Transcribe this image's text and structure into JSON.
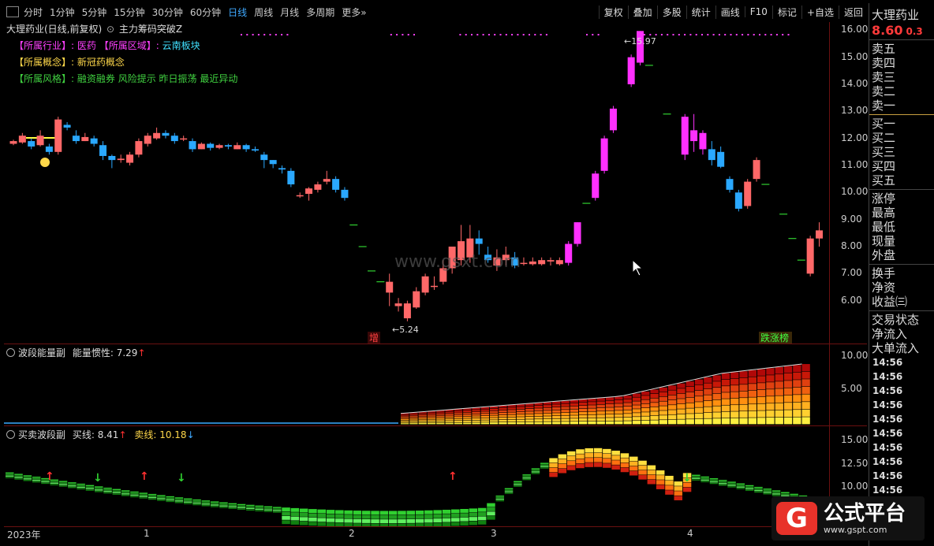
{
  "toolbar": {
    "periods": [
      "分时",
      "1分钟",
      "5分钟",
      "15分钟",
      "30分钟",
      "60分钟",
      "日线",
      "周线",
      "月线",
      "多周期",
      "更多»"
    ],
    "active": "日线",
    "buttons": [
      "复权",
      "叠加",
      "多股",
      "统计",
      "画线",
      "F10",
      "标记",
      "+自选",
      "返回"
    ]
  },
  "main": {
    "title": "大理药业(日线,前复权)",
    "indicator": "主力筹码突破Z",
    "industry_line": {
      "label1": "【所属行业】:",
      "val1": "医药",
      "label2": "【所属区域】:",
      "val2": "云南板块"
    },
    "concept_line": {
      "label": "【所属概念】:",
      "val": "新冠药概念"
    },
    "style_line": {
      "label": "【所属风格】:",
      "val": "融资融券 风险提示 昨日振荡 最近异动"
    },
    "high_label": "15.97",
    "low_label": "5.24",
    "tag_zeng": "增",
    "tag_die": "跌涨榜",
    "watermark": "www.gsxt.com",
    "yticks": [
      "16.00",
      "15.00",
      "14.00",
      "13.00",
      "12.00",
      "11.00",
      "10.00",
      "9.00",
      "8.00",
      "7.00",
      "6.00"
    ]
  },
  "ind1": {
    "name": "波段能量副",
    "label": "能量惯性:",
    "value": "7.29",
    "yticks": [
      "10.00",
      "5.00"
    ]
  },
  "ind2": {
    "name": "买卖波段副",
    "buy_label": "买线:",
    "buy_value": "8.41",
    "sell_label": "卖线:",
    "sell_value": "10.18",
    "yticks": [
      "15.00",
      "12.50",
      "10.00"
    ]
  },
  "xaxis": [
    "2023年",
    "1",
    "2",
    "3",
    "4"
  ],
  "side": {
    "stock": "大理药业",
    "price": "8.60",
    "change": "0.3",
    "items_sell": [
      "卖五",
      "卖四",
      "卖三",
      "卖二",
      "卖一"
    ],
    "items_buy": [
      "买一",
      "买二",
      "买三",
      "买四",
      "买五"
    ],
    "stats": [
      "涨停",
      "最高",
      "最低",
      "现量",
      "外盘"
    ],
    "stats2": [
      "换手",
      "净资",
      "收益㈢"
    ],
    "trade": [
      "交易状态",
      "净流入",
      "大单流入"
    ],
    "times": [
      "14:56",
      "14:56",
      "14:56",
      "14:56",
      "14:56",
      "14:56",
      "14:56",
      "14:56",
      "14:56",
      "14:56",
      "14:56",
      "14:56",
      "14:56"
    ]
  },
  "logo": {
    "mark": "G",
    "name": "公式平台",
    "url": "www.gspt.com"
  },
  "chart_data": {
    "type": "candlestick",
    "ylim": [
      5.0,
      16.3
    ],
    "candles": [
      [
        11.8,
        11.9,
        11.75,
        11.95
      ],
      [
        11.85,
        12.1,
        11.8,
        12.2
      ],
      [
        11.9,
        11.7,
        11.6,
        12.0
      ],
      [
        11.75,
        12.1,
        11.7,
        12.3
      ],
      [
        11.7,
        11.5,
        11.4,
        11.8
      ],
      [
        11.5,
        12.7,
        11.4,
        12.8
      ],
      [
        12.5,
        12.4,
        12.3,
        12.6
      ],
      [
        12.1,
        11.9,
        11.8,
        12.3
      ],
      [
        11.9,
        12.05,
        11.9,
        12.2
      ],
      [
        12.0,
        11.8,
        11.7,
        12.1
      ],
      [
        11.75,
        11.35,
        11.2,
        11.9
      ],
      [
        11.35,
        11.2,
        10.9,
        11.4
      ],
      [
        11.2,
        11.25,
        11.1,
        11.4
      ],
      [
        11.1,
        11.4,
        11.0,
        11.5
      ],
      [
        11.4,
        11.9,
        11.3,
        12.0
      ],
      [
        11.8,
        12.1,
        11.7,
        12.2
      ],
      [
        12.0,
        12.2,
        11.95,
        12.4
      ],
      [
        12.2,
        12.1,
        12.0,
        12.3
      ],
      [
        12.1,
        11.9,
        11.8,
        12.2
      ],
      [
        12.0,
        12.0,
        11.9,
        12.1
      ],
      [
        11.9,
        11.6,
        11.5,
        12.0
      ],
      [
        11.6,
        11.8,
        11.6,
        11.85
      ],
      [
        11.8,
        11.65,
        11.55,
        11.85
      ],
      [
        11.65,
        11.75,
        11.6,
        11.8
      ],
      [
        11.75,
        11.7,
        11.6,
        11.8
      ],
      [
        11.6,
        11.75,
        11.6,
        11.85
      ],
      [
        11.75,
        11.6,
        11.5,
        11.8
      ],
      [
        11.6,
        11.55,
        11.5,
        11.7
      ],
      [
        11.4,
        11.2,
        10.9,
        11.5
      ],
      [
        11.2,
        11.05,
        10.9,
        11.2
      ],
      [
        10.9,
        10.85,
        10.7,
        11.0
      ],
      [
        10.8,
        10.3,
        10.2,
        10.9
      ],
      [
        9.9,
        9.9,
        9.8,
        10.0
      ],
      [
        9.95,
        10.15,
        9.7,
        10.2
      ],
      [
        10.1,
        10.3,
        10.0,
        10.4
      ],
      [
        10.4,
        10.5,
        10.3,
        10.8
      ],
      [
        10.5,
        10.1,
        10.0,
        10.6
      ],
      [
        10.1,
        9.8,
        9.7,
        10.2
      ],
      [
        null,
        8.8,
        null,
        null
      ],
      [
        null,
        8.0,
        null,
        null
      ],
      [
        null,
        7.1,
        null,
        null
      ],
      [
        null,
        6.7,
        null,
        null
      ],
      [
        6.3,
        6.7,
        5.8,
        7.0
      ],
      [
        5.8,
        5.9,
        5.6,
        6.1
      ],
      [
        5.35,
        5.9,
        5.24,
        6.0
      ],
      [
        5.75,
        6.35,
        5.7,
        6.5
      ],
      [
        6.3,
        6.9,
        6.2,
        7.0
      ],
      [
        6.55,
        6.55,
        6.4,
        6.9
      ],
      [
        6.7,
        7.2,
        6.6,
        7.5
      ],
      [
        7.2,
        8.0,
        7.0,
        8.0
      ],
      [
        7.5,
        8.2,
        7.3,
        8.8
      ],
      [
        7.6,
        8.3,
        7.4,
        8.8
      ],
      [
        8.3,
        8.1,
        7.7,
        8.6
      ],
      [
        7.7,
        7.5,
        7.4,
        8.0
      ],
      [
        7.3,
        7.6,
        7.1,
        7.9
      ],
      [
        7.5,
        7.7,
        7.3,
        8.0
      ],
      [
        7.6,
        7.3,
        7.2,
        7.8
      ],
      [
        7.4,
        7.4,
        7.3,
        7.6
      ],
      [
        7.35,
        7.45,
        7.3,
        7.6
      ],
      [
        7.35,
        7.5,
        7.3,
        7.6
      ],
      [
        7.45,
        7.5,
        7.3,
        7.6
      ],
      [
        7.35,
        7.5,
        7.3,
        7.6
      ],
      [
        7.4,
        8.1,
        7.3,
        8.2
      ],
      [
        8.1,
        8.9,
        8.0,
        8.9
      ],
      [
        null,
        9.6,
        null,
        null
      ],
      [
        9.8,
        10.7,
        9.7,
        10.8
      ],
      [
        10.8,
        12.0,
        10.7,
        12.1
      ],
      [
        12.3,
        13.1,
        12.2,
        13.2
      ],
      [
        null,
        null,
        null,
        null
      ],
      [
        14.0,
        15.0,
        13.9,
        15.1
      ],
      [
        14.8,
        15.97,
        14.7,
        15.97
      ],
      [
        null,
        14.7,
        null,
        null
      ],
      [
        null,
        null,
        null,
        null
      ],
      [
        null,
        12.9,
        null,
        null
      ],
      [
        null,
        null,
        null,
        null
      ],
      [
        11.4,
        12.8,
        11.2,
        12.9
      ],
      [
        11.9,
        12.3,
        11.5,
        12.9
      ],
      [
        12.2,
        11.6,
        11.4,
        12.3
      ],
      [
        11.6,
        11.2,
        11.0,
        11.9
      ],
      [
        11.5,
        10.95,
        10.9,
        11.7
      ],
      [
        10.5,
        10.1,
        10.0,
        10.6
      ],
      [
        10.0,
        9.4,
        9.3,
        10.1
      ],
      [
        9.5,
        10.4,
        9.4,
        10.5
      ],
      [
        10.5,
        11.2,
        10.4,
        11.3
      ],
      [
        null,
        10.3,
        null,
        null
      ],
      [
        null,
        null,
        null,
        null
      ],
      [
        null,
        9.2,
        null,
        null
      ],
      [
        null,
        8.3,
        null,
        null
      ],
      [
        null,
        7.5,
        null,
        null
      ],
      [
        7.0,
        8.3,
        6.9,
        8.4
      ],
      [
        8.3,
        8.6,
        8.0,
        8.9
      ]
    ]
  }
}
